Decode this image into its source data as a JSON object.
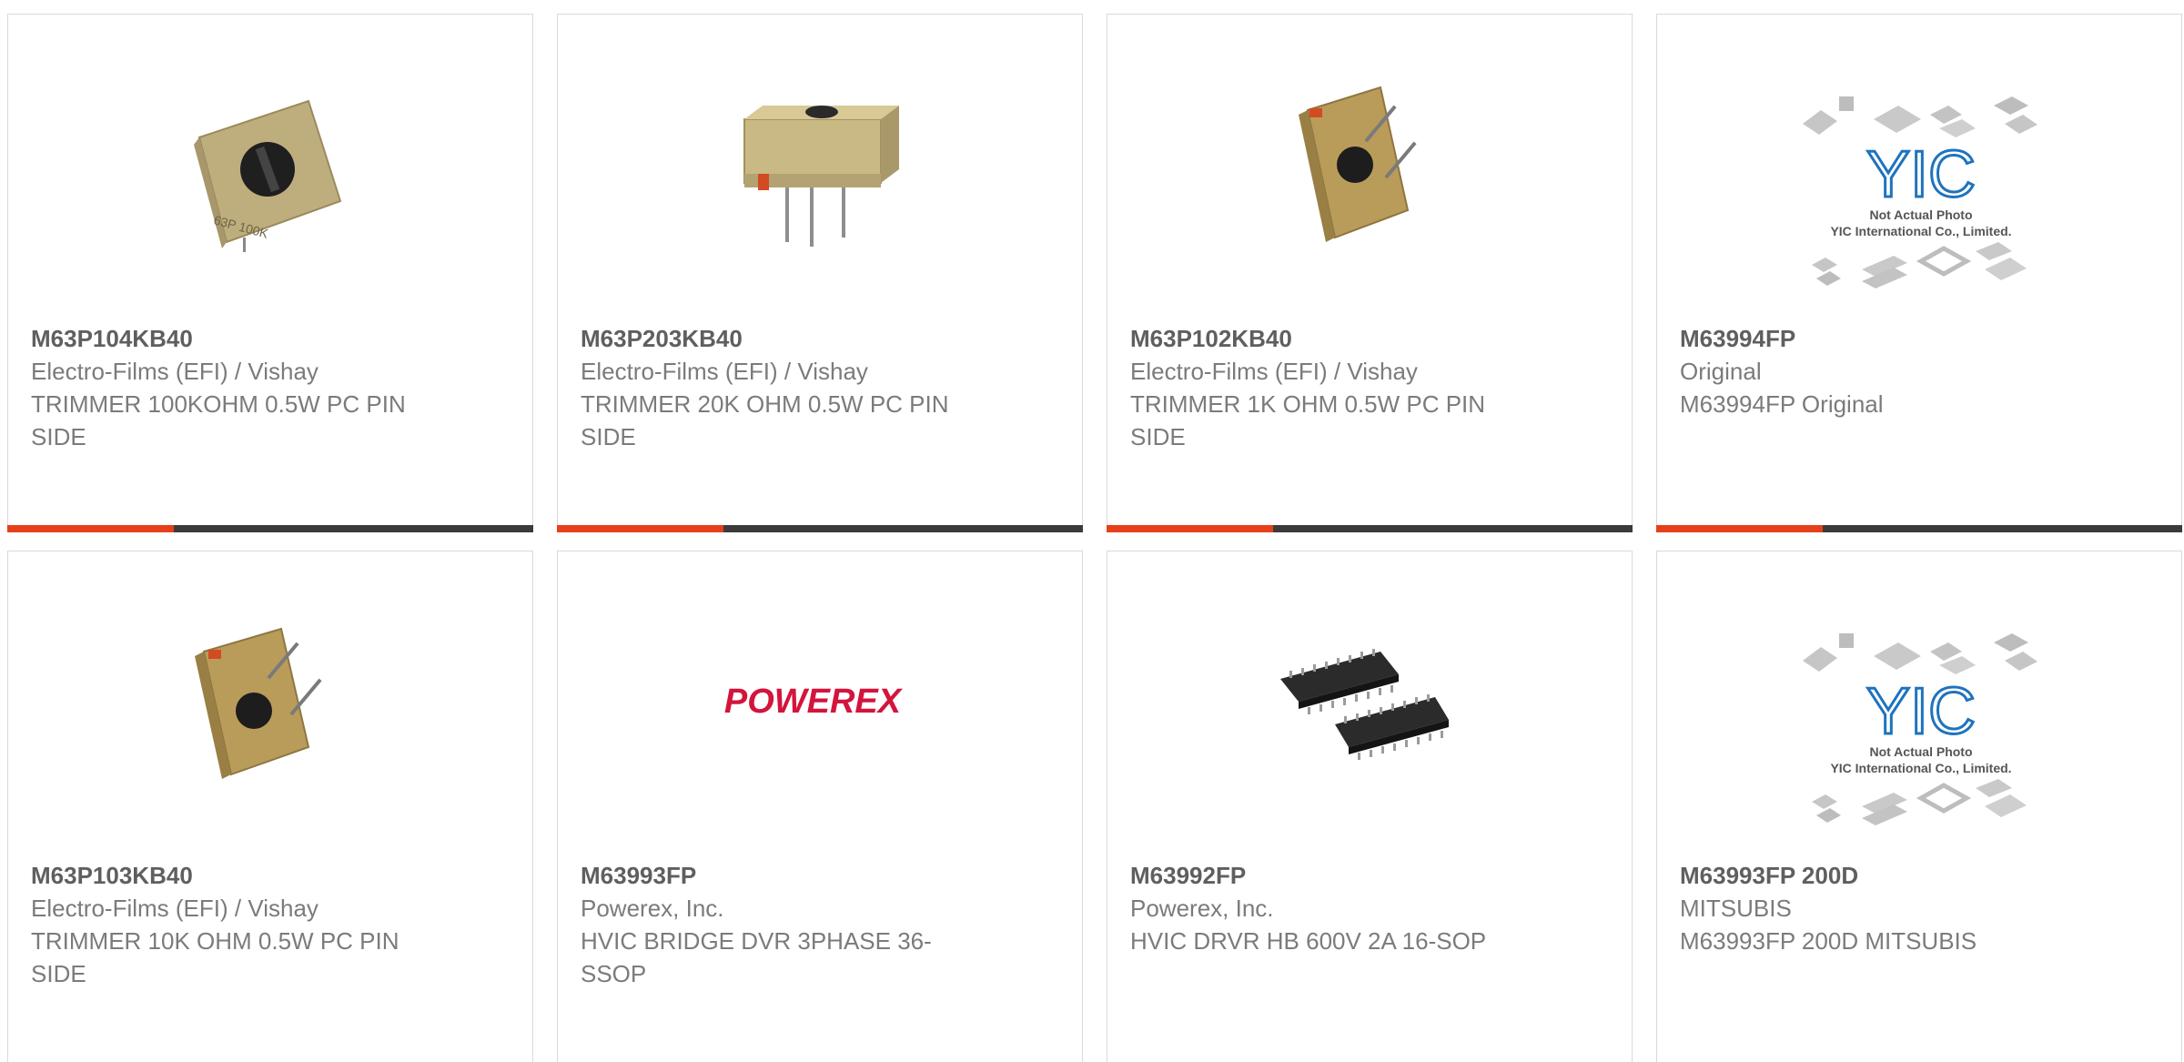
{
  "products": [
    {
      "part_number": "M63P104KB40",
      "manufacturer": "Electro-Films (EFI) / Vishay",
      "description": "TRIMMER 100KOHM 0.5W PC PIN SIDE",
      "image": "trimmer-top-icon",
      "image_text": "63P 100K"
    },
    {
      "part_number": "M63P203KB40",
      "manufacturer": "Electro-Films (EFI) / Vishay",
      "description": "TRIMMER 20K OHM 0.5W PC PIN SIDE",
      "image": "trimmer-front-icon"
    },
    {
      "part_number": "M63P102KB40",
      "manufacturer": "Electro-Films (EFI) / Vishay",
      "description": "TRIMMER 1K OHM 0.5W PC PIN SIDE",
      "image": "trimmer-angled-icon"
    },
    {
      "part_number": "M63994FP",
      "manufacturer": "Original",
      "description": "M63994FP Original",
      "image": "yic-placeholder-icon",
      "image_text": "YIC",
      "image_caption_1": "Not Actual Photo",
      "image_caption_2": "YIC International Co., Limited."
    },
    {
      "part_number": "M63P103KB40",
      "manufacturer": "Electro-Films (EFI) / Vishay",
      "description": "TRIMMER 10K OHM 0.5W PC PIN SIDE",
      "image": "trimmer-angled-icon"
    },
    {
      "part_number": "M63993FP",
      "manufacturer": "Powerex, Inc.",
      "description": "HVIC BRIDGE DVR 3PHASE 36-SSOP",
      "image": "powerex-logo",
      "image_text": "POWEREX"
    },
    {
      "part_number": "M63992FP",
      "manufacturer": "Powerex, Inc.",
      "description": "HVIC DRVR HB 600V 2A 16-SOP",
      "image": "sop-chip-icon"
    },
    {
      "part_number": "M63993FP 200D",
      "manufacturer": "MITSUBIS",
      "description": "M63993FP 200D MITSUBIS",
      "image": "yic-placeholder-icon",
      "image_text": "YIC",
      "image_caption_1": "Not Actual Photo",
      "image_caption_2": "YIC International Co., Limited."
    }
  ],
  "colors": {
    "accent": "#e6401a",
    "bar": "#3b3b3b",
    "text_bold": "#5f5f5f",
    "text": "#7b7b7b",
    "yic_blue": "#1e73be",
    "powerex_red": "#d4143c"
  }
}
